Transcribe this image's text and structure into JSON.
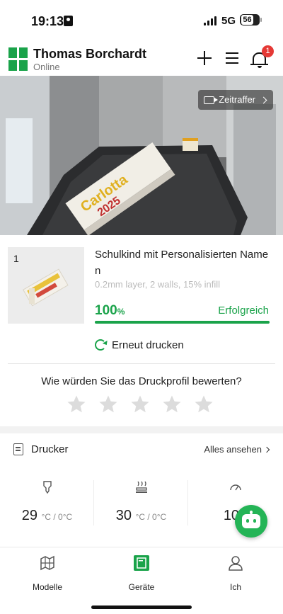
{
  "status_bar": {
    "time": "19:13",
    "network": "5G",
    "battery": "56"
  },
  "header": {
    "user_name": "Thomas Borchardt",
    "user_status": "Online",
    "notification_count": "1"
  },
  "camera": {
    "timelapse_label": "Zeitraffer"
  },
  "job": {
    "plate_number": "1",
    "title": "Schulkind mit Personalisierten Namen",
    "meta": "0.2mm layer, 2 walls, 15% infill",
    "progress_value": "100",
    "progress_unit": "%",
    "progress_fraction": 1.0,
    "status": "Erfolgreich",
    "reprint_label": "Erneut drucken"
  },
  "rating": {
    "question": "Wie würden Sie das Druckprofil bewerten?",
    "stars_filled": 0,
    "stars_total": 5
  },
  "printer_section": {
    "title": "Drucker",
    "see_all": "Alles ansehen"
  },
  "temperatures": [
    {
      "icon": "nozzle-icon",
      "value": "29",
      "unit": "°C / 0°C"
    },
    {
      "icon": "heatbed-icon",
      "value": "30",
      "unit": "°C / 0°C"
    },
    {
      "icon": "speed-gauge-icon",
      "value": "100",
      "unit": ""
    }
  ],
  "bottom_nav": {
    "items": [
      {
        "label": "Modelle",
        "icon": "models-icon"
      },
      {
        "label": "Geräte",
        "icon": "devices-icon"
      },
      {
        "label": "Ich",
        "icon": "profile-icon"
      }
    ]
  },
  "colors": {
    "accent": "#1aa34a",
    "badge": "#e53935",
    "star_empty": "#dcdcdc"
  }
}
